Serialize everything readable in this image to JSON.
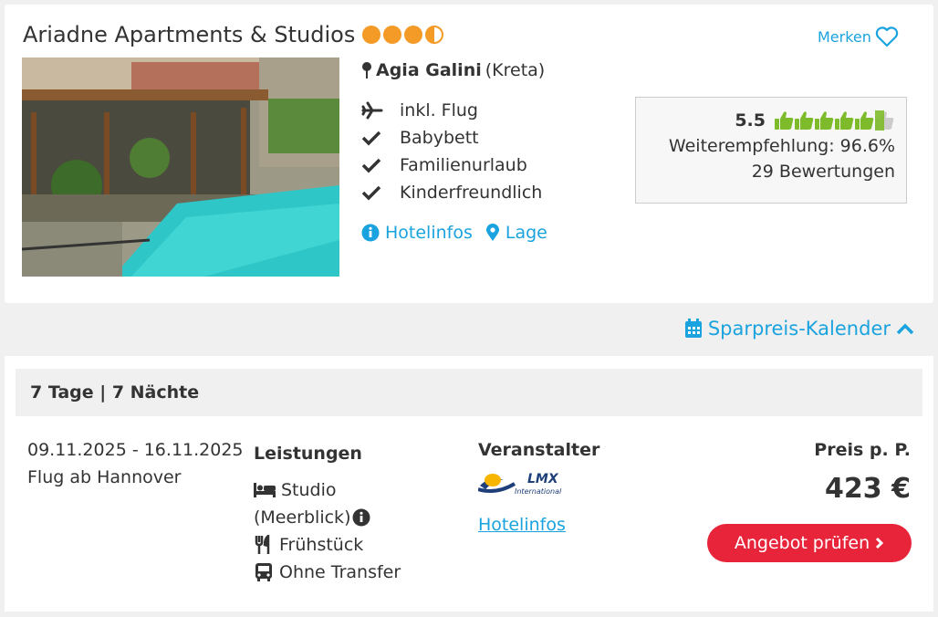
{
  "hotel": {
    "name": "Ariadne Apartments & Studios",
    "stars": 3.5,
    "merken_label": "Merken",
    "location_place": "Agia Galini",
    "location_region": "(Kreta)",
    "features": [
      "inkl. Flug",
      "Babybett",
      "Familienurlaub",
      "Kinderfreundlich"
    ],
    "link_hotelinfos": "Hotelinfos",
    "link_lage": "Lage"
  },
  "rating": {
    "score": "5.5",
    "thumbs": 5.5,
    "recommendation": "Weiterempfehlung: 96.6%",
    "reviews": "29 Bewertungen"
  },
  "calendar": {
    "label": "Sparpreis-Kalender"
  },
  "offer": {
    "duration": "7 Tage | 7 Nächte",
    "dates": "09.11.2025 - 16.11.2025",
    "departure": "Flug ab Hannover",
    "services_title": "Leistungen",
    "room": "Studio",
    "room_detail": "(Meerblick)",
    "board": "Frühstück",
    "transfer": "Ohne Transfer",
    "operator_title": "Veranstalter",
    "operator_logo_text": "LMX",
    "operator_logo_sub": "International",
    "operator_link": "Hotelinfos",
    "price_label": "Preis p. P.",
    "price": "423 €",
    "cta": "Angebot prüfen"
  },
  "colors": {
    "accent": "#1aa3de",
    "stars": "#f49a27",
    "thumbs": "#7dbb2b",
    "cta": "#e8243b"
  }
}
